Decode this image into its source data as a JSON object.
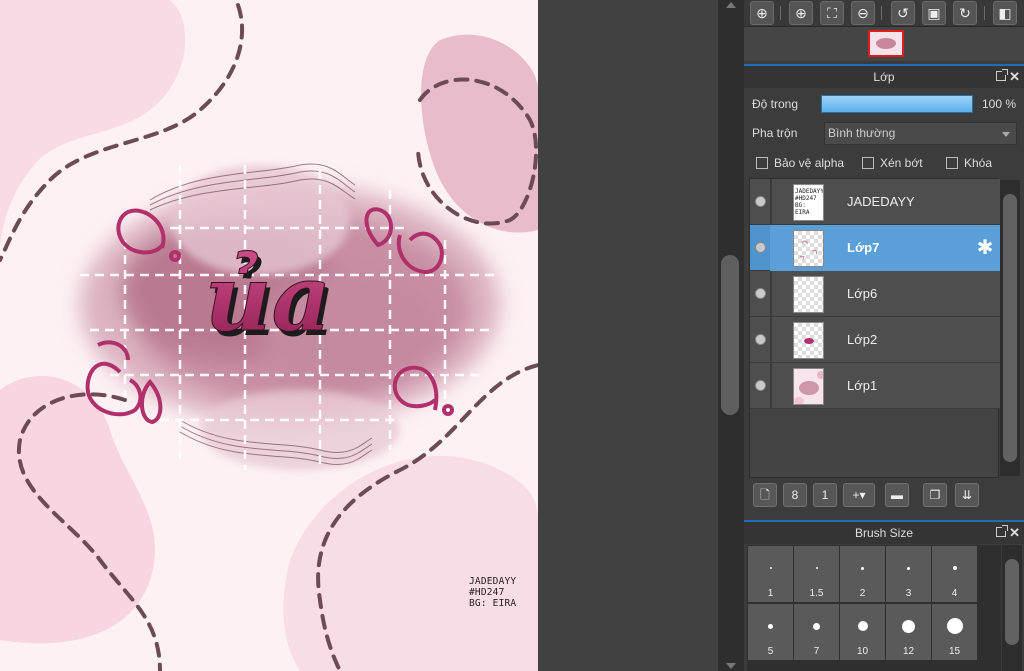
{
  "artwork": {
    "title_text": "ủa",
    "watermark_lines": [
      "JADEDAYY",
      "#HD247",
      "BG: EIRA"
    ],
    "colors": {
      "background": "#fdf1f4",
      "blob": "#f4d3de",
      "mauve": "#c4899d",
      "magenta": "#b0306b",
      "dash": "#6b4b56"
    }
  },
  "navigator_toolbar": {
    "buttons": [
      {
        "name": "zoom-fit-icon",
        "glyph": "⊕"
      },
      {
        "name": "zoom-in-icon",
        "glyph": "⊕"
      },
      {
        "name": "fit-window-icon",
        "glyph": "⛶"
      },
      {
        "name": "zoom-out-icon",
        "glyph": "⊖"
      },
      {
        "name": "rotate-left-icon",
        "glyph": "↺"
      },
      {
        "name": "actual-size-icon",
        "glyph": "▣"
      },
      {
        "name": "rotate-right-icon",
        "glyph": "↻"
      },
      {
        "name": "flip-icon",
        "glyph": "◧"
      }
    ]
  },
  "layer_panel": {
    "title": "Lớp",
    "opacity_label": "Độ trong",
    "opacity_value": "100 %",
    "opacity_percent": 100,
    "blend_label": "Pha trộn",
    "blend_value": "Bình thường",
    "protect_alpha_label": "Bảo vệ alpha",
    "clip_label": "Xén bớt",
    "lock_label": "Khóa",
    "layers": [
      {
        "name": "JADEDAYY",
        "selected": false,
        "thumb_text": [
          "JADEDAYY",
          "#HD247",
          "BG: EIRA"
        ]
      },
      {
        "name": "Lớp7",
        "selected": true
      },
      {
        "name": "Lớp6",
        "selected": false
      },
      {
        "name": "Lớp2",
        "selected": false
      },
      {
        "name": "Lớp1",
        "selected": false
      }
    ]
  },
  "layer_toolbar": {
    "buttons": [
      {
        "name": "new-layer-icon",
        "glyph": "🗋"
      },
      {
        "name": "new-8bit-layer-icon",
        "glyph": "8"
      },
      {
        "name": "new-1bit-layer-icon",
        "glyph": "1"
      },
      {
        "name": "add-layer-menu-icon",
        "glyph": "+▾"
      },
      {
        "name": "folder-icon",
        "glyph": "▬"
      },
      {
        "name": "duplicate-layer-icon",
        "glyph": "❐"
      },
      {
        "name": "merge-layer-icon",
        "glyph": "⇊"
      }
    ]
  },
  "brush_panel": {
    "title": "Brush Size",
    "sizes": [
      "1",
      "1.5",
      "2",
      "3",
      "4",
      "5",
      "7",
      "10",
      "12",
      "15"
    ]
  }
}
